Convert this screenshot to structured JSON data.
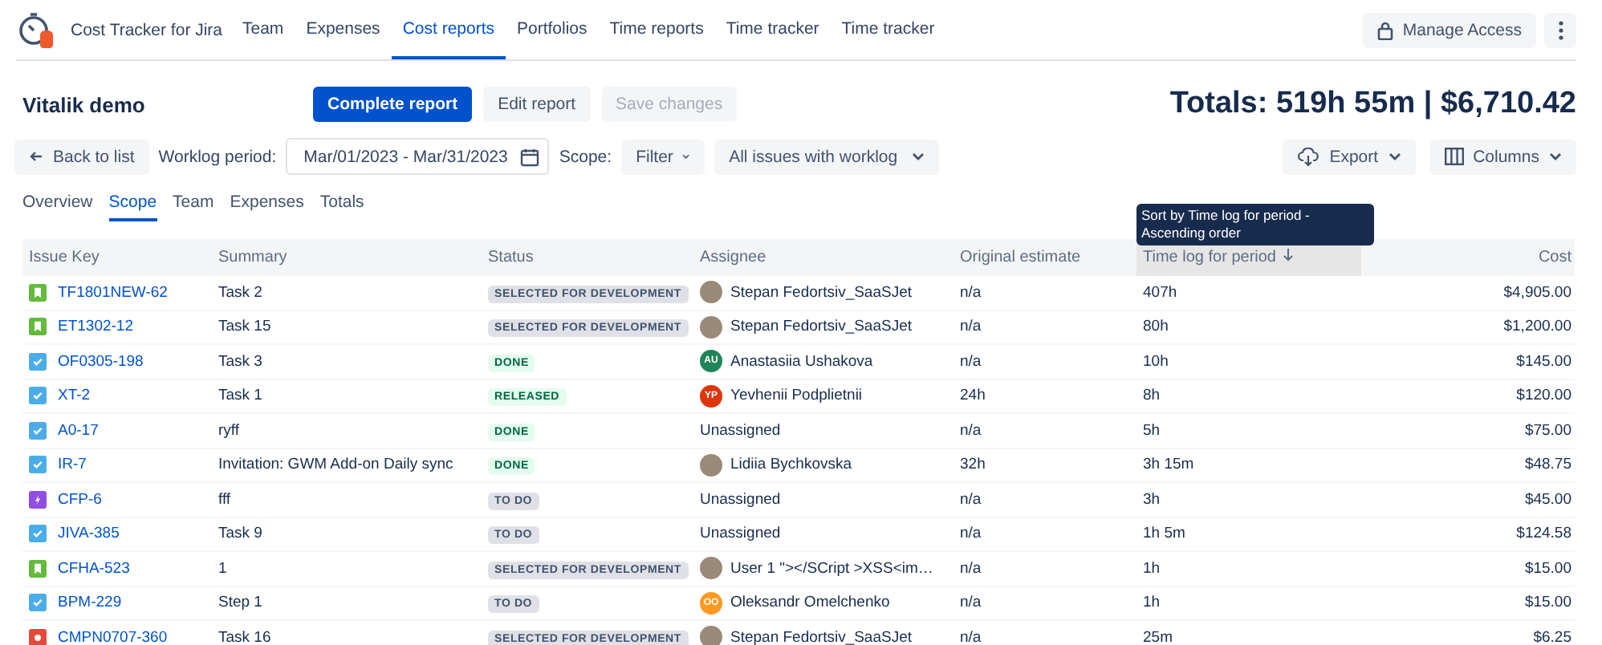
{
  "app": {
    "name": "Cost Tracker for Jira"
  },
  "nav": [
    {
      "label": "Team",
      "selected": false
    },
    {
      "label": "Expenses",
      "selected": false
    },
    {
      "label": "Cost reports",
      "selected": true
    },
    {
      "label": "Portfolios",
      "selected": false
    },
    {
      "label": "Time reports",
      "selected": false
    },
    {
      "label": "Time tracker",
      "selected": false
    },
    {
      "label": "Time tracker",
      "selected": false
    }
  ],
  "manage_access": "Manage Access",
  "report": {
    "title": "Vitalik demo",
    "totals": "Totals: 519h 55m | $6,710.42"
  },
  "actions": [
    {
      "label": "Complete report",
      "kind": "primary",
      "disabled": false
    },
    {
      "label": "Edit report",
      "kind": "default",
      "disabled": false
    },
    {
      "label": "Save changes",
      "kind": "default",
      "disabled": true
    }
  ],
  "filters": {
    "back": "Back to list",
    "period_label": "Worklog period:",
    "period": "Mar/01/2023 - Mar/31/2023",
    "scope_label": "Scope:",
    "scope": "Filter",
    "issues": "All issues with worklog",
    "export": "Export",
    "columns": "Columns"
  },
  "subtabs": [
    {
      "label": "Overview",
      "selected": false
    },
    {
      "label": "Scope",
      "selected": true
    },
    {
      "label": "Team",
      "selected": false
    },
    {
      "label": "Expenses",
      "selected": false
    },
    {
      "label": "Totals",
      "selected": false
    }
  ],
  "tooltip": "Sort by Time log for period - Ascending order",
  "table": {
    "columns": [
      {
        "label": "Issue Key",
        "sorted": false
      },
      {
        "label": "Summary",
        "sorted": false
      },
      {
        "label": "Status",
        "sorted": false
      },
      {
        "label": "Assignee",
        "sorted": false
      },
      {
        "label": "Original estimate",
        "sorted": false
      },
      {
        "label": "Time log for period",
        "sorted": true
      },
      {
        "label": "Cost",
        "sorted": false
      }
    ],
    "rows": [
      {
        "issue_type": {
          "kind": "story"
        },
        "key": "TF1801NEW-62",
        "summary": "Task 2",
        "status": {
          "label": "SELECTED FOR DEVELOPMENT",
          "kind": "default"
        },
        "assignee": {
          "kind": "photo",
          "name": "Stepan Fedortsiv_SaaSJet"
        },
        "estimate": "n/a",
        "time": "407h",
        "cost": "$4,905.00"
      },
      {
        "issue_type": {
          "kind": "story"
        },
        "key": "ET1302-12",
        "summary": "Task 15",
        "status": {
          "label": "SELECTED FOR DEVELOPMENT",
          "kind": "default"
        },
        "assignee": {
          "kind": "photo",
          "name": "Stepan Fedortsiv_SaaSJet"
        },
        "estimate": "n/a",
        "time": "80h",
        "cost": "$1,200.00"
      },
      {
        "issue_type": {
          "kind": "task"
        },
        "key": "OF0305-198",
        "summary": "Task 3",
        "status": {
          "label": "DONE",
          "kind": "success"
        },
        "assignee": {
          "kind": "initials",
          "initials": "AU",
          "color": "#1f845a",
          "name": "Anastasiia Ushakova"
        },
        "estimate": "n/a",
        "time": "10h",
        "cost": "$145.00"
      },
      {
        "issue_type": {
          "kind": "task"
        },
        "key": "XT-2",
        "summary": "Task 1",
        "status": {
          "label": "RELEASED",
          "kind": "success"
        },
        "assignee": {
          "kind": "initials",
          "initials": "YP",
          "color": "#de350b",
          "name": "Yevhenii Podplietnii"
        },
        "estimate": "24h",
        "time": "8h",
        "cost": "$120.00"
      },
      {
        "issue_type": {
          "kind": "task"
        },
        "key": "A0-17",
        "summary": "ryff",
        "status": {
          "label": "DONE",
          "kind": "success"
        },
        "assignee": {
          "kind": "none",
          "name": "Unassigned"
        },
        "estimate": "n/a",
        "time": "5h",
        "cost": "$75.00"
      },
      {
        "issue_type": {
          "kind": "task"
        },
        "key": "IR-7",
        "summary": "Invitation: GWM Add-on Daily sync",
        "status": {
          "label": "DONE",
          "kind": "success"
        },
        "assignee": {
          "kind": "photo",
          "name": "Lidiia Bychkovska"
        },
        "estimate": "32h",
        "time": "3h 15m",
        "cost": "$48.75"
      },
      {
        "issue_type": {
          "kind": "subtask"
        },
        "key": "CFP-6",
        "summary": "fff",
        "status": {
          "label": "TO DO",
          "kind": "default"
        },
        "assignee": {
          "kind": "none",
          "name": "Unassigned"
        },
        "estimate": "n/a",
        "time": "3h",
        "cost": "$45.00"
      },
      {
        "issue_type": {
          "kind": "task"
        },
        "key": "JIVA-385",
        "summary": "Task 9",
        "status": {
          "label": "TO DO",
          "kind": "default"
        },
        "assignee": {
          "kind": "none",
          "name": "Unassigned"
        },
        "estimate": "n/a",
        "time": "1h 5m",
        "cost": "$124.58"
      },
      {
        "issue_type": {
          "kind": "story"
        },
        "key": "CFHA-523",
        "summary": "1",
        "status": {
          "label": "SELECTED FOR DEVELOPMENT",
          "kind": "default"
        },
        "assignee": {
          "kind": "photo",
          "name": "User 1 \"></SCript >XSS<im…"
        },
        "estimate": "n/a",
        "time": "1h",
        "cost": "$15.00"
      },
      {
        "issue_type": {
          "kind": "task"
        },
        "key": "BPM-229",
        "summary": "Step 1",
        "status": {
          "label": "TO DO",
          "kind": "default"
        },
        "assignee": {
          "kind": "initials",
          "initials": "OO",
          "color": "#ff991f",
          "name": "Oleksandr Omelchenko"
        },
        "estimate": "n/a",
        "time": "1h",
        "cost": "$15.00"
      },
      {
        "issue_type": {
          "kind": "bug"
        },
        "key": "CMPN0707-360",
        "summary": "Task 16",
        "status": {
          "label": "SELECTED FOR DEVELOPMENT",
          "kind": "default"
        },
        "assignee": {
          "kind": "photo",
          "name": "Stepan Fedortsiv_SaaSJet"
        },
        "estimate": "n/a",
        "time": "25m",
        "cost": "$6.25"
      }
    ]
  }
}
